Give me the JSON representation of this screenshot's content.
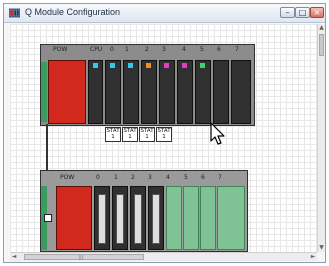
{
  "window": {
    "title": "Q Module Configuration",
    "buttons": {
      "minimize": "–",
      "maximize": "□",
      "close": "×"
    }
  },
  "main_base": {
    "slot_labels": [
      "POW",
      "CPU",
      "0",
      "1",
      "2",
      "3",
      "4",
      "5",
      "6",
      "7"
    ],
    "status_boxes": [
      {
        "label": "STAT",
        "value": "1"
      },
      {
        "label": "STAT",
        "value": "1"
      },
      {
        "label": "STAT",
        "value": "1"
      },
      {
        "label": "STAT",
        "value": "1"
      }
    ]
  },
  "extension_base": {
    "slot_labels": [
      "POW",
      "0",
      "1",
      "2",
      "3",
      "4",
      "5",
      "6",
      "7"
    ]
  },
  "scrollbars": {
    "up_arrow": "▲",
    "down_arrow": "▼",
    "left_arrow": "◄",
    "right_arrow": "►",
    "grip": "|||"
  },
  "colors": {
    "power_supply": "#d2291f",
    "module": "#303030",
    "empty_extension_slot": "#7fc394",
    "led_cyan": "#32c8f0",
    "led_orange": "#f08a2a",
    "led_magenta": "#e43ec0",
    "led_green": "#3fd16b"
  }
}
